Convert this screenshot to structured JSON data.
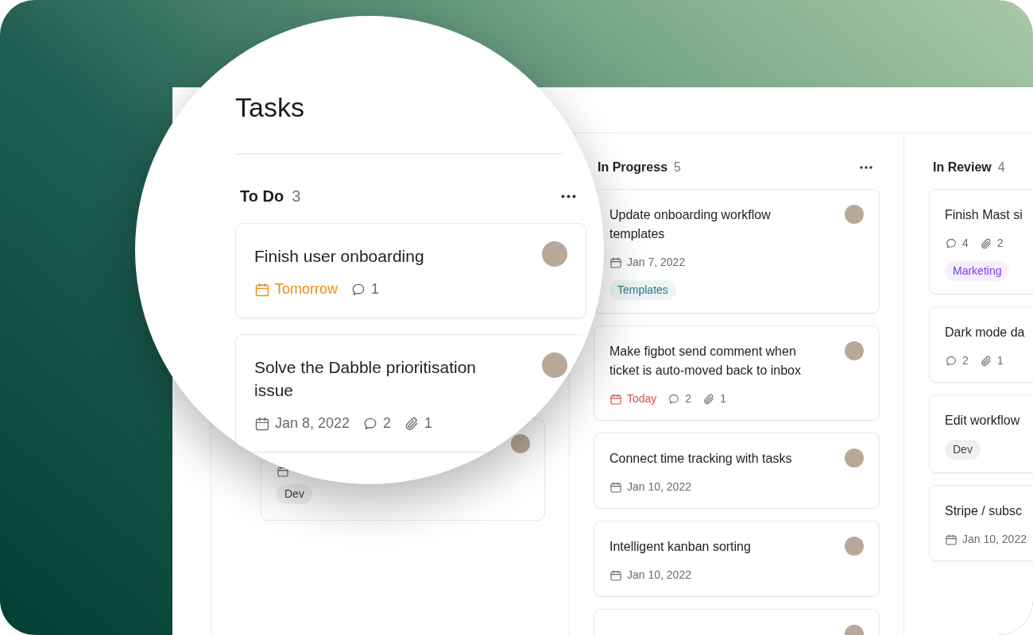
{
  "magnifier": {
    "title": "Tasks",
    "column": {
      "name": "To Do",
      "count": "3",
      "cards": [
        {
          "title": "Finish user onboarding",
          "due": {
            "text": "Tomorrow",
            "color": "#f08c12"
          },
          "comments": "1",
          "avatar": true
        },
        {
          "title": "Solve the Dabble prioritisation issue",
          "due": {
            "text": "Jan 8, 2022",
            "color": "#6b6b6b"
          },
          "comments": "2",
          "attachments": "1",
          "avatar": true
        }
      ]
    }
  },
  "hidden_card": {
    "avatar": true,
    "tags": [
      {
        "label": "Dev",
        "color": "#3f3f46"
      }
    ]
  },
  "columns": [
    {
      "name": "In Progress",
      "count": "5",
      "cards": [
        {
          "title": "Update onboarding workflow templates",
          "due": {
            "text": "Jan 7, 2022",
            "color": "#6b6b6b"
          },
          "avatar": true,
          "tags": [
            {
              "label": "Templates",
              "color": "#2b7685"
            }
          ]
        },
        {
          "title": "Make figbot send comment when ticket is auto-moved back to inbox",
          "due": {
            "text": "Today",
            "color": "#e5484d"
          },
          "comments": "2",
          "attachments": "1",
          "avatar": true
        },
        {
          "title": "Connect time tracking with tasks",
          "due": {
            "text": "Jan 10, 2022",
            "color": "#6b6b6b"
          },
          "avatar": true
        },
        {
          "title": "Intelligent kanban sorting",
          "due": {
            "text": "Jan 10, 2022",
            "color": "#6b6b6b"
          },
          "avatar": true
        },
        {
          "avatar": true
        }
      ]
    },
    {
      "name": "In Review",
      "count": "4",
      "cards": [
        {
          "title": "Finish Mast si",
          "comments": "4",
          "attachments": "2",
          "tags": [
            {
              "label": "Marketing",
              "color": "#7c3aed"
            }
          ]
        },
        {
          "title": "Dark mode da",
          "comments": "2",
          "attachments": "1"
        },
        {
          "title": "Edit workflow",
          "tags": [
            {
              "label": "Dev",
              "color": "#3f3f46"
            }
          ]
        },
        {
          "title": "Stripe / subsc",
          "due": {
            "text": "Jan 10, 2022",
            "color": "#6b6b6b"
          }
        }
      ]
    }
  ]
}
